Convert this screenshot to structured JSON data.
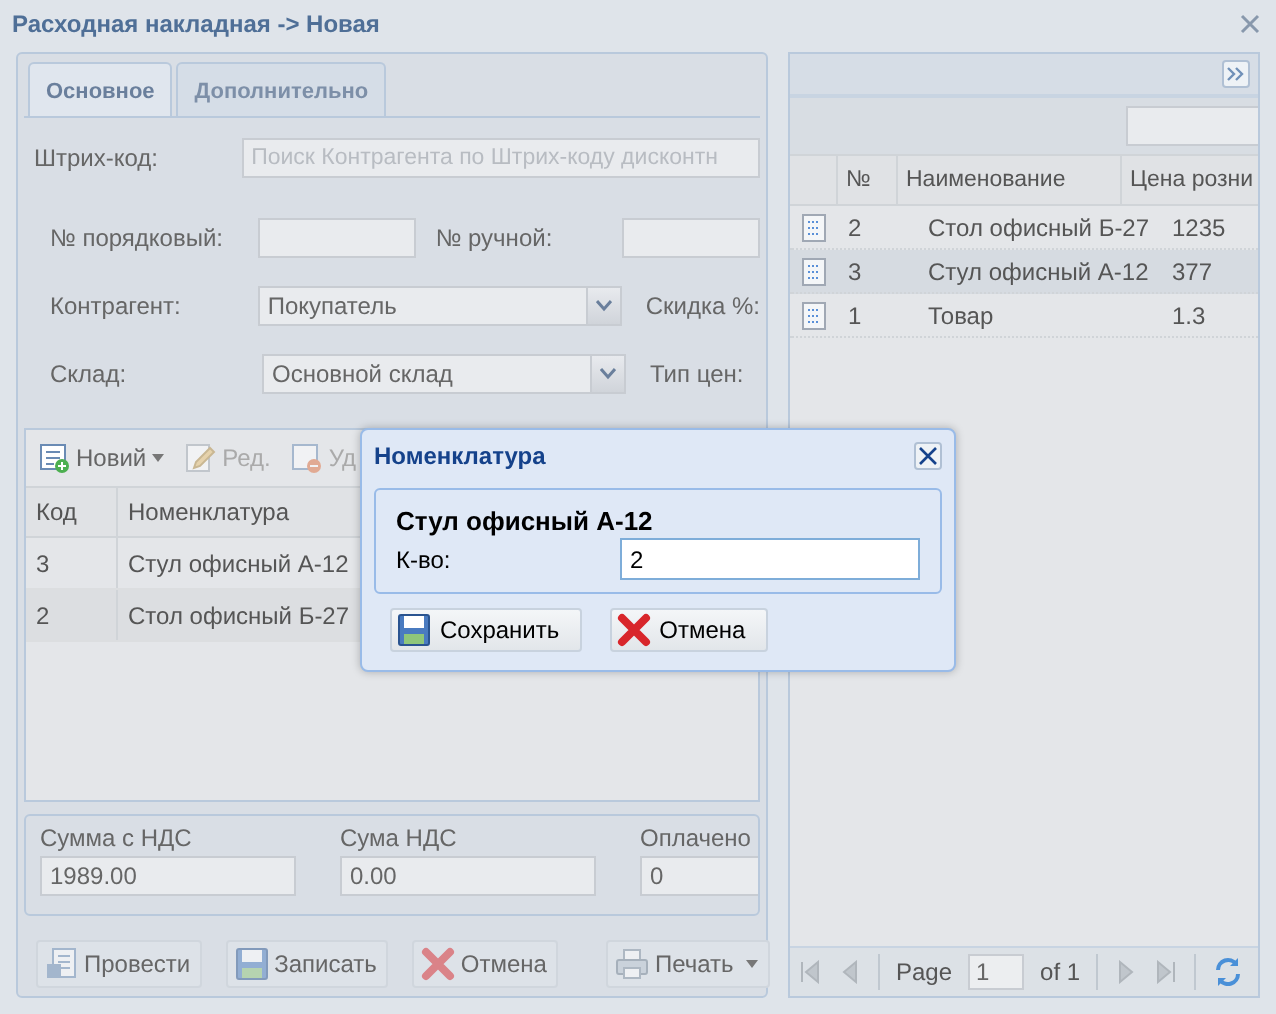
{
  "window": {
    "title": "Расходная накладная -> Новая"
  },
  "tabs": [
    {
      "label": "Основное",
      "selected": true
    },
    {
      "label": "Дополнительно",
      "selected": false
    }
  ],
  "form": {
    "barcode": {
      "label": "Штрих-код:",
      "placeholder": "Поиск Контрагента по Штрих-коду дисконтн"
    },
    "number_seq": {
      "label": "№ порядковый:"
    },
    "number_manual": {
      "label": "№ ручной:"
    },
    "counterparty": {
      "label": "Контрагент:",
      "value": "Покупатель"
    },
    "discount": {
      "label": "Скидка %:"
    },
    "warehouse": {
      "label": "Склад:",
      "value": "Основной склад"
    },
    "price_type": {
      "label": "Тип цен:"
    }
  },
  "items_toolbar": [
    {
      "label": "Новий",
      "kind": "new",
      "disabled": false,
      "has_menu": true
    },
    {
      "label": "Ред.",
      "kind": "edit",
      "disabled": true,
      "has_menu": false
    },
    {
      "label": "Уд",
      "kind": "delete",
      "disabled": true,
      "has_menu": false
    }
  ],
  "items_table": {
    "columns": [
      "Код",
      "Номенклатура"
    ],
    "rows": [
      [
        "3",
        "Стул офисный А-12"
      ],
      [
        "2",
        "Стол офисный Б-27"
      ]
    ]
  },
  "totals": [
    {
      "label": "Сумма с НДС",
      "value": "1989.00"
    },
    {
      "label": "Сума НДС",
      "value": "0.00"
    },
    {
      "label": "Оплачено",
      "value": "0"
    }
  ],
  "actions": [
    {
      "label": "Провести",
      "kind": "post",
      "has_menu": false
    },
    {
      "label": "Записать",
      "kind": "save",
      "has_menu": false
    },
    {
      "label": "Отмена",
      "kind": "cancel",
      "has_menu": false
    },
    {
      "label": "Печать",
      "kind": "print",
      "has_menu": true
    }
  ],
  "catalog": {
    "columns": [
      "№",
      "Наименование",
      "Цена розни"
    ],
    "rows": [
      {
        "cells": [
          "2",
          "Стол офисный Б-27",
          "1235"
        ],
        "selected": false
      },
      {
        "cells": [
          "3",
          "Стул офисный А-12",
          "377"
        ],
        "selected": true
      },
      {
        "cells": [
          "1",
          "Товар",
          "1.3"
        ],
        "selected": false
      }
    ]
  },
  "pager": {
    "label": "Page",
    "value": "1",
    "total": "of 1"
  },
  "dialog": {
    "title": "Номенклатура",
    "item": "Стул офисный А-12",
    "qty_label": "К-во:",
    "qty_value": "2",
    "buttons": [
      {
        "label": "Сохранить",
        "kind": "save"
      },
      {
        "label": "Отмена",
        "kind": "cancel"
      }
    ]
  }
}
